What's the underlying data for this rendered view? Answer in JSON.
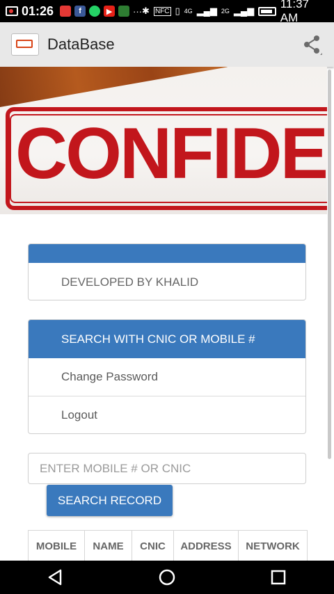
{
  "status_bar": {
    "recording_time": "01:26",
    "clock": "11:37 AM",
    "network_4g": "4G",
    "network_2g": "2G",
    "nfc": "NFC",
    "more": "···"
  },
  "app_bar": {
    "title": "DataBase"
  },
  "banner": {
    "stamp_text": "CONFIDEN"
  },
  "credit_card": {
    "header": "",
    "text": "DEVELOPED BY KHALID"
  },
  "menu": {
    "header": "SEARCH WITH CNIC OR MOBILE #",
    "items": [
      {
        "label": "Change Password"
      },
      {
        "label": "Logout"
      }
    ]
  },
  "search": {
    "value": "",
    "placeholder": "ENTER MOBILE # OR CNIC",
    "button_label": "SEARCH RECORD"
  },
  "table": {
    "columns": [
      "MOBILE",
      "NAME",
      "CNIC",
      "ADDRESS",
      "NETWORK"
    ]
  },
  "colors": {
    "accent": "#3a79bd",
    "stamp_red": "#c2161c"
  },
  "icons": {
    "share": "share-icon",
    "back": "back-icon",
    "home": "home-icon",
    "recents": "recents-icon"
  }
}
